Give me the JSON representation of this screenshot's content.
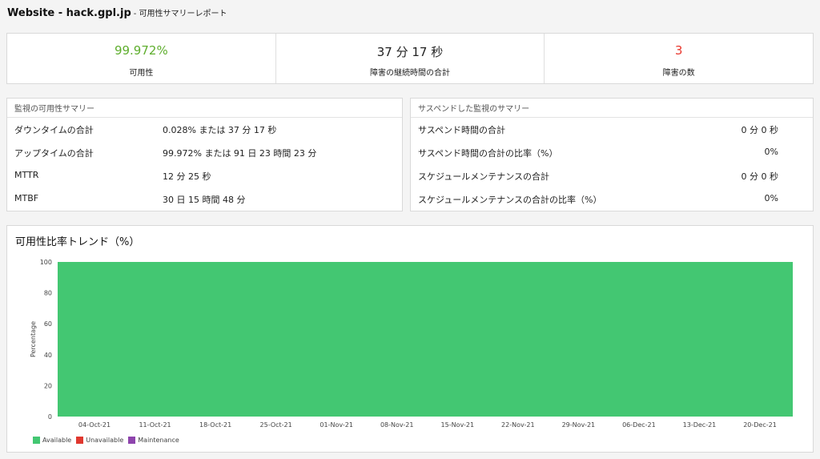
{
  "header": {
    "title": "Website - hack.gpl.jp",
    "subtitle": "- 可用性サマリーレポート"
  },
  "stats": [
    {
      "value": "99.972%",
      "label": "可用性",
      "color": "#5fae2e"
    },
    {
      "value": "37 分 17 秒",
      "label": "障害の継続時間の合計",
      "color": "#222222"
    },
    {
      "value": "3",
      "label": "障害の数",
      "color": "#e8362d"
    }
  ],
  "availability_summary": {
    "title": "監視の可用性サマリー",
    "rows": [
      {
        "key": "ダウンタイムの合計",
        "value": "0.028% または 37 分 17 秒"
      },
      {
        "key": "アップタイムの合計",
        "value": "99.972% または 91 日 23 時間 23 分"
      },
      {
        "key": "MTTR",
        "value": "12 分 25 秒"
      },
      {
        "key": "MTBF",
        "value": "30 日 15 時間 48 分"
      }
    ]
  },
  "suspended_summary": {
    "title": "サスペンドした監視のサマリー",
    "rows": [
      {
        "key": "サスペンド時間の合計",
        "value": "0 分 0 秒"
      },
      {
        "key": "サスペンド時間の合計の比率（%）",
        "value": "0%"
      },
      {
        "key": "スケジュールメンテナンスの合計",
        "value": "0 分 0 秒"
      },
      {
        "key": "スケジュールメンテナンスの合計の比率（%）",
        "value": "0%"
      }
    ]
  },
  "chart_panel_title": "可用性比率トレンド（%）",
  "chart_data": {
    "type": "area",
    "ylabel": "Percentage",
    "ylim": [
      0,
      100
    ],
    "yticks": [
      0,
      20,
      40,
      60,
      80,
      100
    ],
    "xticks": [
      "04-Oct-21",
      "11-Oct-21",
      "18-Oct-21",
      "25-Oct-21",
      "01-Nov-21",
      "08-Nov-21",
      "15-Nov-21",
      "22-Nov-21",
      "29-Nov-21",
      "06-Dec-21",
      "13-Dec-21",
      "20-Dec-21"
    ],
    "series": [
      {
        "name": "Available",
        "color": "#43c772",
        "values": [
          100,
          100,
          100,
          100,
          99.97,
          100,
          100,
          100,
          100,
          100,
          100,
          100
        ]
      },
      {
        "name": "Unavailable",
        "color": "#e0382f",
        "values": [
          0,
          0,
          0,
          0,
          0.03,
          0,
          0,
          0,
          0,
          0,
          0,
          0
        ]
      },
      {
        "name": "Maintenance",
        "color": "#8e44ad",
        "values": [
          0,
          0,
          0,
          0,
          0,
          0,
          0,
          0,
          0,
          0,
          0,
          0
        ]
      }
    ],
    "legend_position": "bottom-left"
  }
}
